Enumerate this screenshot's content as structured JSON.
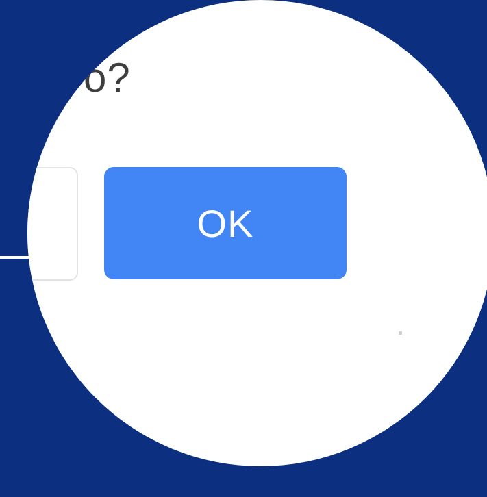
{
  "dialog": {
    "question_fragment": "ó?",
    "ok_label": "OK"
  },
  "colors": {
    "backdrop": "#0c2f80",
    "magnifier": "#ffffff",
    "primary_button": "#4285f4",
    "text": "#3e3e3e"
  }
}
